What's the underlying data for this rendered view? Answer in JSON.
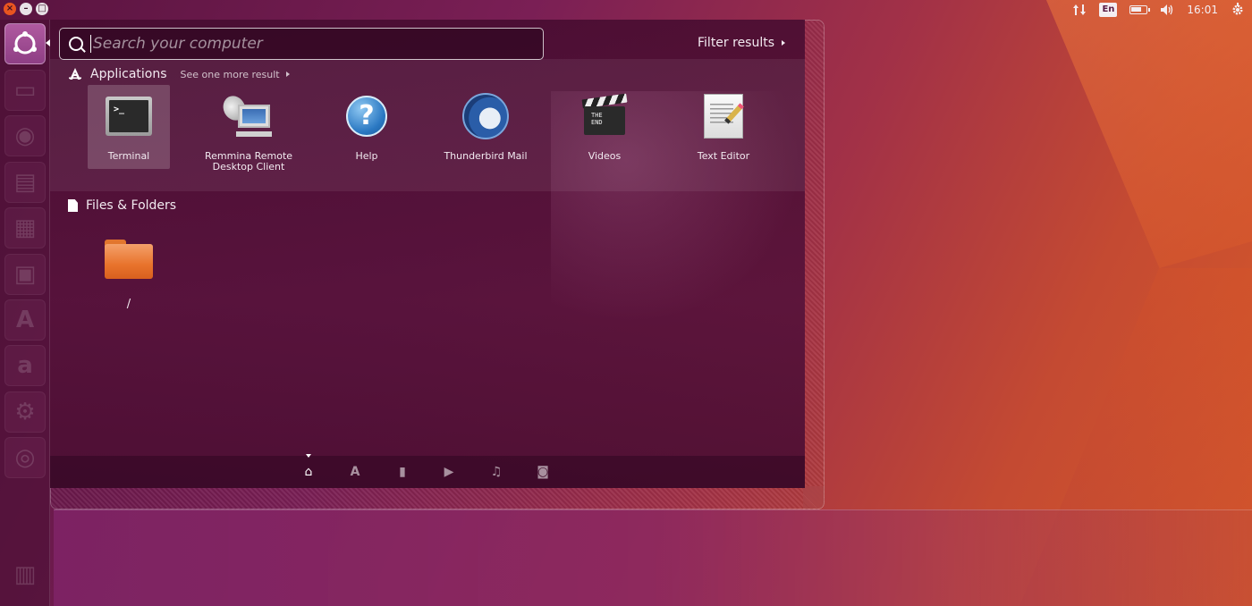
{
  "top_panel": {
    "window_controls": [
      "×",
      "–",
      "□"
    ],
    "indicators": {
      "network_icon": "network-updown-icon",
      "keyboard_layout": "En",
      "battery_icon": "battery-icon",
      "volume_icon": "volume-icon",
      "clock": "16:01",
      "session_icon": "gear-icon"
    }
  },
  "launcher": {
    "items": [
      {
        "name": "dash-home",
        "glyph": "◎"
      },
      {
        "name": "files",
        "glyph": "▭"
      },
      {
        "name": "firefox",
        "glyph": "◉"
      },
      {
        "name": "libreoffice-writer",
        "glyph": "▤"
      },
      {
        "name": "libreoffice-calc",
        "glyph": "▦"
      },
      {
        "name": "libreoffice-impress",
        "glyph": "▣"
      },
      {
        "name": "software-center",
        "glyph": "A"
      },
      {
        "name": "amazon",
        "glyph": "a"
      },
      {
        "name": "system-settings",
        "glyph": "⚙"
      },
      {
        "name": "disc",
        "glyph": "◎"
      },
      {
        "name": "trash",
        "glyph": "▥"
      }
    ]
  },
  "dash": {
    "search": {
      "value": "",
      "placeholder": "Search your computer"
    },
    "filter_label": "Filter results",
    "categories": {
      "applications": {
        "title": "Applications",
        "see_more": "See one more result",
        "items": [
          {
            "label": "Terminal",
            "icon": "terminal-icon"
          },
          {
            "label": "Remmina Remote Desktop Client",
            "icon": "remmina-icon"
          },
          {
            "label": "Help",
            "icon": "help-icon"
          },
          {
            "label": "Thunderbird Mail",
            "icon": "thunderbird-icon"
          },
          {
            "label": "Videos",
            "icon": "videos-icon"
          },
          {
            "label": "Text Editor",
            "icon": "text-editor-icon"
          }
        ]
      },
      "files": {
        "title": "Files & Folders",
        "items": [
          {
            "label": "/",
            "icon": "folder-icon"
          }
        ]
      }
    },
    "lenses": [
      {
        "name": "home",
        "glyph": "⌂",
        "active": true
      },
      {
        "name": "applications",
        "glyph": "A",
        "active": false
      },
      {
        "name": "files",
        "glyph": "▮",
        "active": false
      },
      {
        "name": "video",
        "glyph": "▶",
        "active": false
      },
      {
        "name": "music",
        "glyph": "♫",
        "active": false
      },
      {
        "name": "photos",
        "glyph": "◙",
        "active": false
      }
    ]
  },
  "colors": {
    "accent": "#e95420",
    "aubergine": "#5a1440",
    "text": "#f2eaf0"
  }
}
